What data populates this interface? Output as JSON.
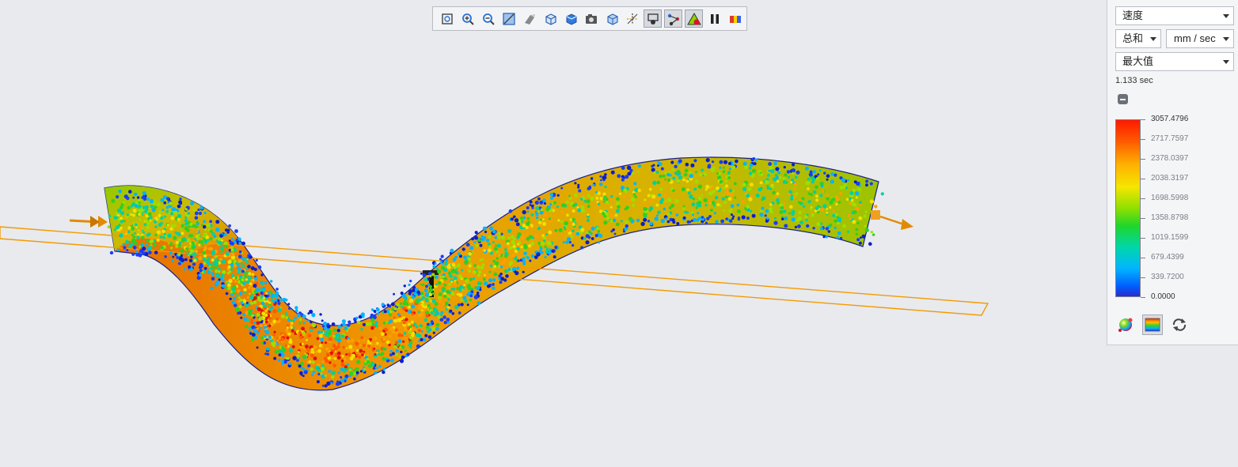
{
  "toolbar": {
    "buttons": [
      {
        "name": "zoom-fit-icon",
        "active": false
      },
      {
        "name": "zoom-in-icon",
        "active": false
      },
      {
        "name": "zoom-out-icon",
        "active": false
      },
      {
        "name": "window-zoom-icon",
        "active": false
      },
      {
        "name": "shading-icon",
        "active": false
      },
      {
        "name": "view-cube-icon",
        "active": false
      },
      {
        "name": "display-style-icon",
        "active": false
      },
      {
        "name": "camera-icon",
        "active": false
      },
      {
        "name": "saved-views-icon",
        "active": false
      },
      {
        "name": "axis-display-icon",
        "active": false
      },
      {
        "name": "probe-icon",
        "active": true
      },
      {
        "name": "particle-trace-icon",
        "active": true
      },
      {
        "name": "contour-warning-icon",
        "active": true
      },
      {
        "name": "pause-icon",
        "active": false
      },
      {
        "name": "legend-toggle-icon",
        "active": false
      }
    ]
  },
  "panel": {
    "quantity_select": "速度",
    "component_select": "总和",
    "unit_select": "mm / sec",
    "stat_select": "最大值",
    "time": "1.133 sec",
    "legend": {
      "max": "3057.4796",
      "labels": [
        "3057.4796",
        "2717.7597",
        "2378.0397",
        "2038.3197",
        "1698.5998",
        "1358.8798",
        "1019.1599",
        "679.4399",
        "339.7200",
        "0.0000"
      ],
      "min": "0.0000"
    },
    "bottom_buttons": [
      "color-sphere-icon",
      "color-bar-icon",
      "reset-cycle-icon"
    ]
  },
  "colors": {
    "background": "#e8eaee",
    "plane_outline": "#f59a00",
    "inlet_arrow": "#e28a00"
  }
}
